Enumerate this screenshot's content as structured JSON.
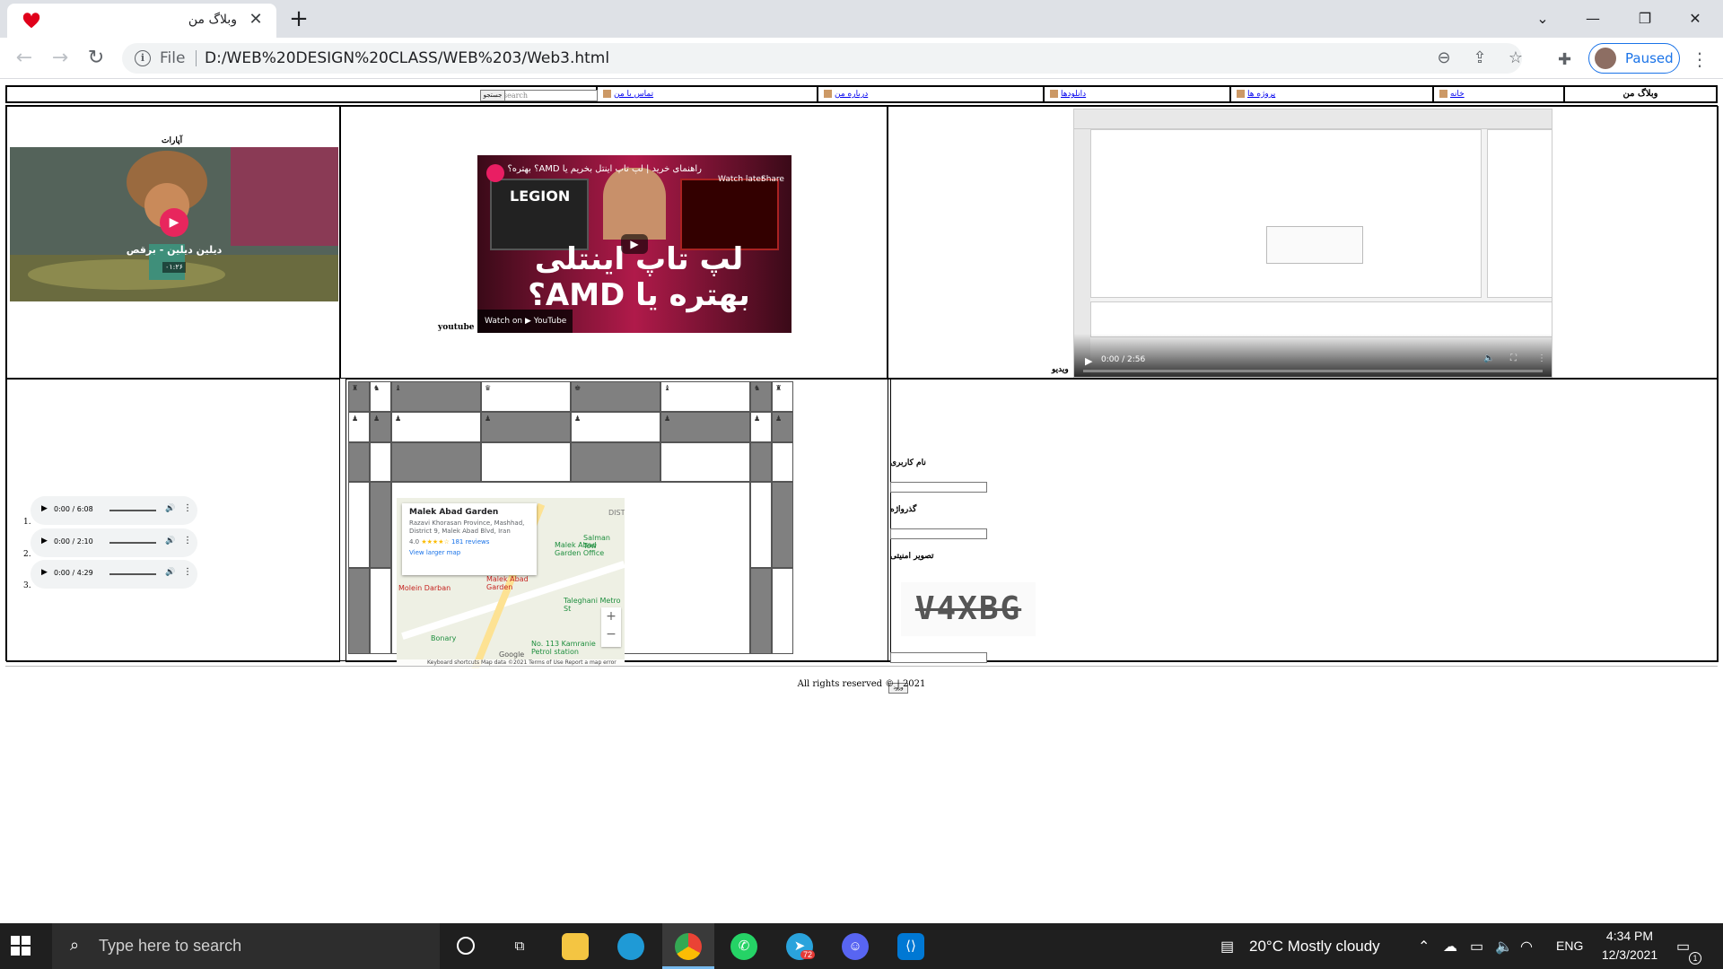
{
  "browser": {
    "tab_title": "وبلاگ من",
    "tab_close": "✕",
    "new_tab": "+",
    "file_label": "File",
    "url": "D:/WEB%20DESIGN%20CLASS/WEB%203/Web3.html",
    "profile_label": "Paused",
    "window_min": "—",
    "window_restore": "❐",
    "window_close": "✕",
    "tab_search": "⌄"
  },
  "nav": {
    "brand": "وبلاگ من",
    "items": [
      "خانه",
      "پروژه ها",
      "دانلودها",
      "درباره من",
      "تماس با من"
    ],
    "search_placeholder": "search",
    "search_button": "جستجو"
  },
  "media": {
    "aparat_label": "آپارات",
    "aparat_title": "دیلین دیلین - برقص",
    "aparat_duration": "۰۱:۲۶",
    "youtube_label": "youtube",
    "yt_title": "راهنمای خرید | لپ تاپ اینتل بخریم یا AMD؟ بهتره؟",
    "yt_big_text": "لپ تاپ اینتلی بهتره یا AMD؟",
    "yt_legion": "LEGION",
    "yt_watch_later": "Watch later",
    "yt_share": "Share",
    "yt_watch_on": "Watch on ▶ YouTube",
    "video_label": "ویدیو",
    "video_time": "0:00 / 2:56"
  },
  "audio": [
    {
      "num": "1.",
      "time": "0:00 / 6:08"
    },
    {
      "num": "2.",
      "time": "0:00 / 2:10"
    },
    {
      "num": "3.",
      "time": "0:00 / 4:29"
    }
  ],
  "map": {
    "name": "Malek Abad Garden",
    "address": "Razavi Khorasan Province, Mashhad, District 9, Malek Abad Blvd, Iran",
    "rating": "4.0",
    "stars": "★★★★☆",
    "reviews": "181 reviews",
    "view_larger": "View larger map",
    "poi_1": "Malek Abad Garden Office",
    "poi_2": "Malek Abad Garden",
    "poi_3": "Molein Darban",
    "poi_4": "Salman Tow",
    "poi_5": "Taleghani Metro St",
    "poi_6": "No. 113 Kamranie Petrol station",
    "poi_7": "Bonary",
    "poi_8": "DIST",
    "footer": "Keyboard shortcuts   Map data ©2021   Terms of Use   Report a map error",
    "google": "Google"
  },
  "form": {
    "username_label": "نام کاربری",
    "password_label": "گذرواژه",
    "captcha_label": "تصویر امنیتی",
    "captcha_text": "V4XBG",
    "submit_label": "ورود"
  },
  "footer": "All rights reserved © | 2021",
  "taskbar": {
    "search_text": "Type here to search",
    "weather": "20°C  Mostly cloudy",
    "lang": "ENG",
    "time": "4:34 PM",
    "date": "12/3/2021",
    "telegram_badge": "72",
    "notif_badge": "1"
  },
  "colors": {
    "accent": "#1a73e8",
    "taskbar": "#1f1f1f",
    "table_gray": "#808080"
  }
}
